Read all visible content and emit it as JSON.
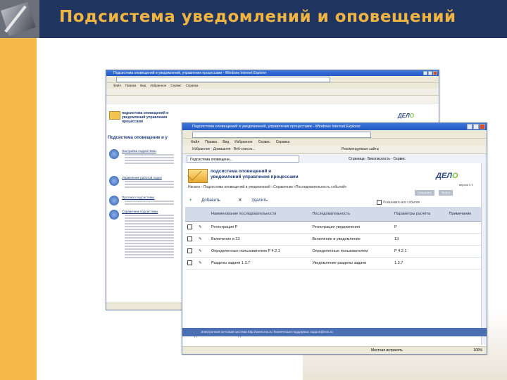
{
  "slide": {
    "title": "Подсистема уведомлений и оповещений"
  },
  "window_back": {
    "title": "Подсистема оповещений и уведомлений, управления процессами - Windows Internet Explorer",
    "menu": [
      "Файл",
      "Правка",
      "Вид",
      "Избранное",
      "Сервис",
      "Справка"
    ],
    "app_title_line1": "подсистема оповещений и",
    "app_title_line2": "уведомлений управления процессами",
    "section_title": "Подсистема оповещение и у",
    "items": [
      "Настройка подсистемы",
      "Управление работой подси",
      "Протокол подсистемы",
      "Справочник подсистемы"
    ]
  },
  "window_front": {
    "title": "Подсистема оповещений и уведомлений, управления процессами - Windows Internet Explorer",
    "menu": [
      "Файл",
      "Правка",
      "Вид",
      "Избранное",
      "Сервис",
      "Справка"
    ],
    "favorites": "Избранное",
    "fav_link": "Домашняя · Веб-список...",
    "fav_link2": "Рекомендуемые сайты",
    "tab_label": "Подсистема оповещени...",
    "tab_tools": "Страница · Безопасность · Сервис",
    "app_title_line1": "подсистема оповещений и",
    "app_title_line2": "уведомлений управления процессами",
    "version": "версия 9.3",
    "breadcrumb": "Начало › Подсистема оповещений и уведомлений › Справочник «Последовательность событий»",
    "buttons": [
      "Сохранить",
      "Выйти"
    ],
    "filter_label": "Показывать все события",
    "actions": {
      "add": "Добавить",
      "delete": "Удалить"
    },
    "columns": [
      "",
      "",
      "Наименование последовательности",
      "Последовательность",
      "Параметры расчёта",
      "Примечание"
    ],
    "rows": [
      {
        "name": "Регистрация Р",
        "sequence": "Регистрация уведомления",
        "params": "Р",
        "note": ""
      },
      {
        "name": "Включение в 13",
        "sequence": "Включение в уведомление",
        "params": "13",
        "note": ""
      },
      {
        "name": "Определенные пользователем Р 4.2.1",
        "sequence": "Определенные пользователем",
        "params": "Р 4.2.1",
        "note": ""
      },
      {
        "name": "Разделы задачи 1.3.7",
        "sequence": "Уведомление разделы задачи",
        "params": "1.3.7",
        "note": ""
      }
    ],
    "bottom_actions": {
      "add": "Добавить",
      "delete": "Удалить"
    },
    "footer": "Электронная почтовая система http://www.eos.ru  Техническая поддержка: support@eos.ru",
    "status_zone": "Местная интрасеть",
    "status_zoom": "100%"
  }
}
